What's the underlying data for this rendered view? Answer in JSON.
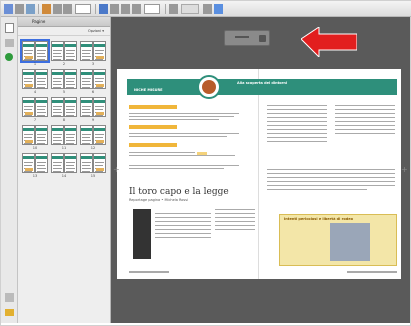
{
  "panel": {
    "title": "Pagine",
    "options_label": "Opzioni"
  },
  "thumbnails": [
    {
      "label": "1"
    },
    {
      "label": "2"
    },
    {
      "label": "3"
    },
    {
      "label": "4"
    },
    {
      "label": "5"
    },
    {
      "label": "6"
    },
    {
      "label": "7"
    },
    {
      "label": "8"
    },
    {
      "label": "9"
    },
    {
      "label": "10"
    },
    {
      "label": "11"
    },
    {
      "label": "12"
    },
    {
      "label": "13"
    },
    {
      "label": "14"
    },
    {
      "label": "15"
    }
  ],
  "document": {
    "left_band": "NICHE MISURE",
    "right_band": "Alla scoperta dei dintorni",
    "headline": "Il toro capo e la legge",
    "subhead": "Reportage pagina • Michela Rossi",
    "inset_title": "Intenti pericolosi e libertà di rodeo"
  },
  "colors": {
    "band": "#2e8f7b",
    "accent": "#f0b63a",
    "arrow": "#e21e1e",
    "selection": "#3d6fe0"
  }
}
